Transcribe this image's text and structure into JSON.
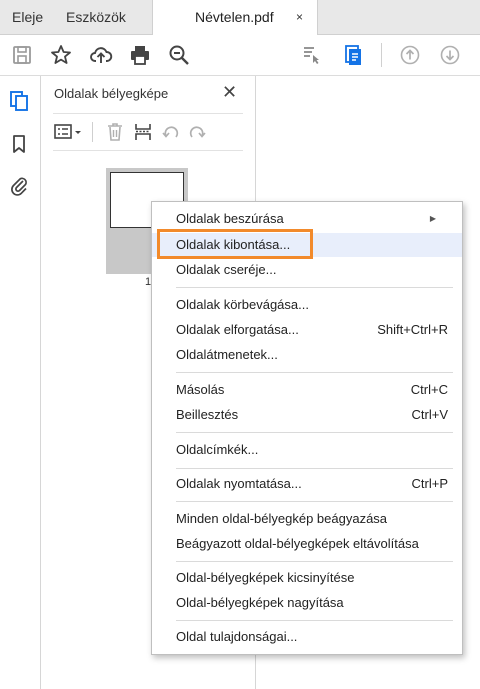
{
  "tabs": {
    "home": "Eleje",
    "tools": "Eszközök",
    "file": "Névtelen.pdf",
    "close_glyph": "×"
  },
  "panel": {
    "title": "Oldalak bélyegképe",
    "close_glyph": "✕",
    "page_number": "1"
  },
  "menu": {
    "items": [
      {
        "label": "Oldalak beszúrása",
        "shortcut": "",
        "submenu": true
      },
      {
        "label": "Oldalak kibontása...",
        "shortcut": "",
        "highlighted": true
      },
      {
        "label": "Oldalak cseréje...",
        "shortcut": ""
      },
      {
        "label": "Oldalak körbevágása...",
        "shortcut": ""
      },
      {
        "label": "Oldalak elforgatása...",
        "shortcut": "Shift+Ctrl+R"
      },
      {
        "label": "Oldalátmenetek...",
        "shortcut": ""
      },
      {
        "label": "Másolás",
        "shortcut": "Ctrl+C"
      },
      {
        "label": "Beillesztés",
        "shortcut": "Ctrl+V"
      },
      {
        "label": "Oldalcímkék...",
        "shortcut": ""
      },
      {
        "label": "Oldalak nyomtatása...",
        "shortcut": "Ctrl+P"
      },
      {
        "label": "Minden oldal-bélyegkép beágyazása",
        "shortcut": ""
      },
      {
        "label": "Beágyazott oldal-bélyegképek eltávolítása",
        "shortcut": ""
      },
      {
        "label": "Oldal-bélyegképek kicsinyítése",
        "shortcut": ""
      },
      {
        "label": "Oldal-bélyegképek nagyítása",
        "shortcut": ""
      },
      {
        "label": "Oldal tulajdonságai...",
        "shortcut": ""
      }
    ]
  },
  "colors": {
    "accent_blue": "#1473e6",
    "highlight_orange": "#f28a2b",
    "icon_gray": "#555555",
    "disabled_gray": "#b0b0b0"
  }
}
